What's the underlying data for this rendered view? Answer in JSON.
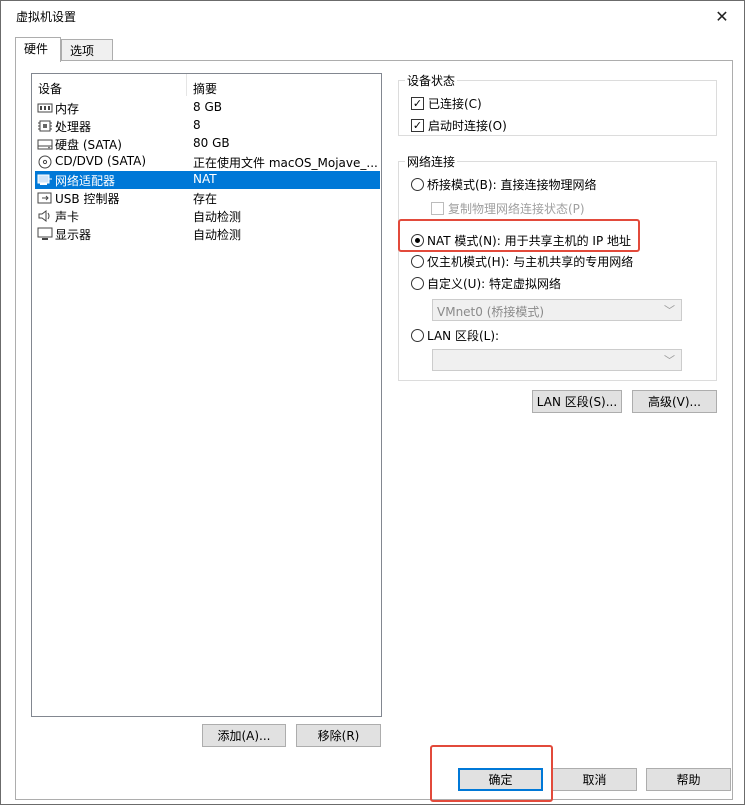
{
  "window": {
    "title": "虚拟机设置",
    "close_glyph": "✕"
  },
  "tabs": [
    {
      "label": "硬件"
    },
    {
      "label": "选项"
    }
  ],
  "devices": {
    "col_device": "设备",
    "col_summary": "摘要",
    "rows": [
      {
        "name": "内存",
        "summary": "8 GB",
        "icon": "memory-icon"
      },
      {
        "name": "处理器",
        "summary": "8",
        "icon": "processor-icon"
      },
      {
        "name": "硬盘 (SATA)",
        "summary": "80 GB",
        "icon": "harddisk-icon"
      },
      {
        "name": "CD/DVD (SATA)",
        "summary": "正在使用文件 macOS_Mojave_...",
        "icon": "cd-dvd-icon"
      },
      {
        "name": "网络适配器",
        "summary": "NAT",
        "icon": "network-adapter-icon",
        "selected": true
      },
      {
        "name": "USB 控制器",
        "summary": "存在",
        "icon": "usb-icon"
      },
      {
        "name": "声卡",
        "summary": "自动检测",
        "icon": "sound-icon"
      },
      {
        "name": "显示器",
        "summary": "自动检测",
        "icon": "display-icon"
      }
    ],
    "add_label": "添加(A)...",
    "remove_label": "移除(R)"
  },
  "device_status": {
    "title": "设备状态",
    "connected_label": "已连接(C)",
    "connect_at_power_on_label": "启动时连接(O)",
    "connected": true,
    "connect_at_power_on": true
  },
  "network": {
    "title": "网络连接",
    "bridged_label": "桥接模式(B): 直接连接物理网络",
    "replicate_label": "复制物理网络连接状态(P)",
    "nat_label": "NAT 模式(N): 用于共享主机的 IP 地址",
    "hostonly_label": "仅主机模式(H): 与主机共享的专用网络",
    "custom_label": "自定义(U): 特定虚拟网络",
    "vmnet_value": "VMnet0 (桥接模式)",
    "lan_label": "LAN 区段(L):",
    "lan_value": "",
    "selected_mode": "nat"
  },
  "adv_buttons": {
    "lan_segments": "LAN 区段(S)...",
    "advanced": "高级(V)..."
  },
  "footer": {
    "ok": "确定",
    "cancel": "取消",
    "help": "帮助"
  },
  "colors": {
    "selection": "#0078d7",
    "highlight": "#e24a3b"
  }
}
